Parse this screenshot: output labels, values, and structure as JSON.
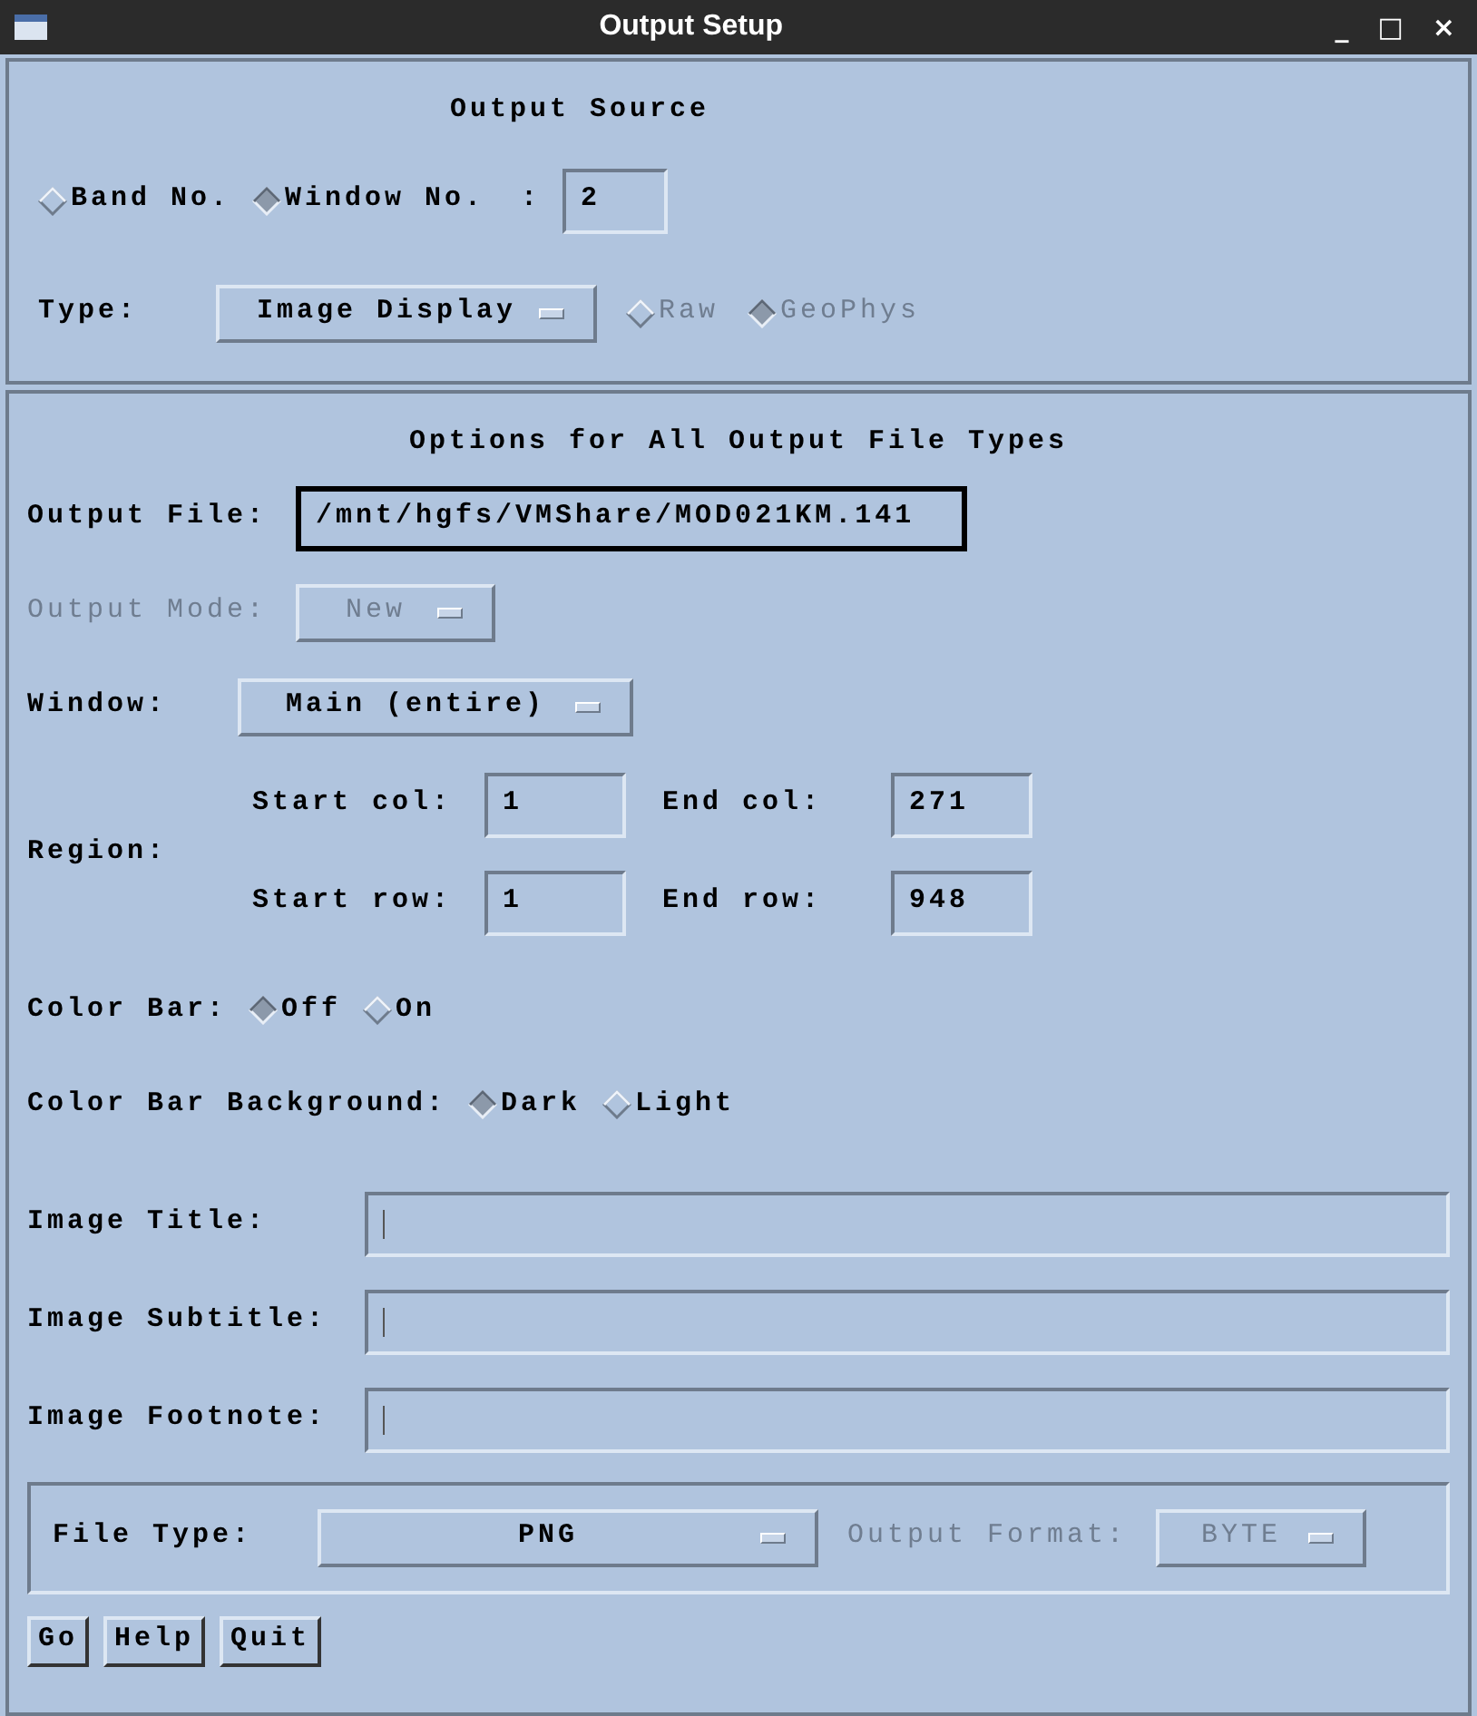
{
  "window": {
    "title": "Output Setup",
    "controls": [
      "_",
      "□",
      "×"
    ]
  },
  "output_source": {
    "heading": "Output Source",
    "radios": [
      {
        "label": "Band No.",
        "selected": false
      },
      {
        "label": "Window No.",
        "selected": true
      }
    ],
    "colon": ":",
    "number": "2",
    "type_label": "Type:",
    "type_menu": {
      "value": "Image Display",
      "disabled": false
    },
    "type_radios": [
      {
        "label": "Raw",
        "selected": false,
        "disabled": true
      },
      {
        "label": "GeoPhys",
        "selected": true,
        "disabled": true
      }
    ]
  },
  "options": {
    "heading": "Options for All Output File Types",
    "output_file": {
      "label": "Output File:",
      "value": "/mnt/hgfs/VMShare/MOD021KM.141"
    },
    "output_mode": {
      "label": "Output Mode:",
      "value": "New",
      "disabled": true
    },
    "window": {
      "label": "Window:",
      "value": "Main (entire)",
      "disabled": false
    },
    "region": {
      "label": "Region:",
      "fields": [
        {
          "label": "Start col:",
          "value": "1"
        },
        {
          "label": "End col:",
          "value": "271"
        },
        {
          "label": "Start row:",
          "value": "1"
        },
        {
          "label": "End row:",
          "value": "948"
        }
      ]
    },
    "color_bar": {
      "label": "Color Bar:",
      "radios": [
        {
          "label": "Off",
          "selected": true
        },
        {
          "label": "On",
          "selected": false
        }
      ]
    },
    "color_bar_background": {
      "label": "Color Bar Background:",
      "radios": [
        {
          "label": "Dark",
          "selected": true
        },
        {
          "label": "Light",
          "selected": false
        }
      ]
    },
    "text_fields": [
      {
        "label": "Image Title:"
      },
      {
        "label": "Image Subtitle:"
      },
      {
        "label": "Image Footnote:"
      }
    ],
    "file_type": {
      "label": "File Type:",
      "value": "PNG",
      "disabled": false
    },
    "output_format": {
      "label": "Output Format:",
      "value": "BYTE",
      "disabled": true
    }
  },
  "buttons": [
    "Go",
    "Help",
    "Quit"
  ]
}
